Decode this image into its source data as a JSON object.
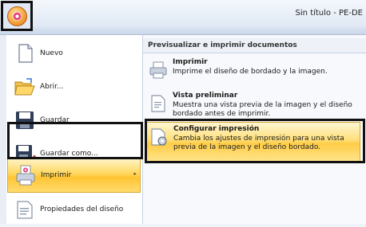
{
  "window": {
    "title": "Sin título - PE-DE"
  },
  "menu": {
    "items": [
      {
        "label": "Nuevo",
        "icon": "new-document-icon"
      },
      {
        "label": "Abrir...",
        "icon": "open-folder-icon"
      },
      {
        "label": "Guardar",
        "icon": "save-disk-icon"
      },
      {
        "label": "Guardar como...",
        "icon": "save-as-icon"
      },
      {
        "label": "Imprimir",
        "icon": "print-icon",
        "active": true,
        "arrow": "▸"
      },
      {
        "label": "Propiedades del diseño",
        "icon": "properties-icon"
      }
    ]
  },
  "submenu": {
    "header": "Previsualizar e imprimir documentos",
    "items": [
      {
        "title": "Imprimir",
        "description": "Imprime el diseño de bordado y la imagen.",
        "icon": "printer-icon"
      },
      {
        "title": "Vista preliminar",
        "description": "Muestra una vista previa de la imagen y el diseño bordado antes de imprimir.",
        "icon": "print-preview-icon"
      },
      {
        "title": "Configurar impresión",
        "description": "Cambia los ajustes de impresión para una vista previa de la imagen y el diseño bordado.",
        "icon": "print-setup-icon",
        "active": true
      }
    ]
  },
  "colors": {
    "highlight": "#ffd75c",
    "highlight_border": "#d9a834",
    "annotation_frame": "#111111"
  }
}
